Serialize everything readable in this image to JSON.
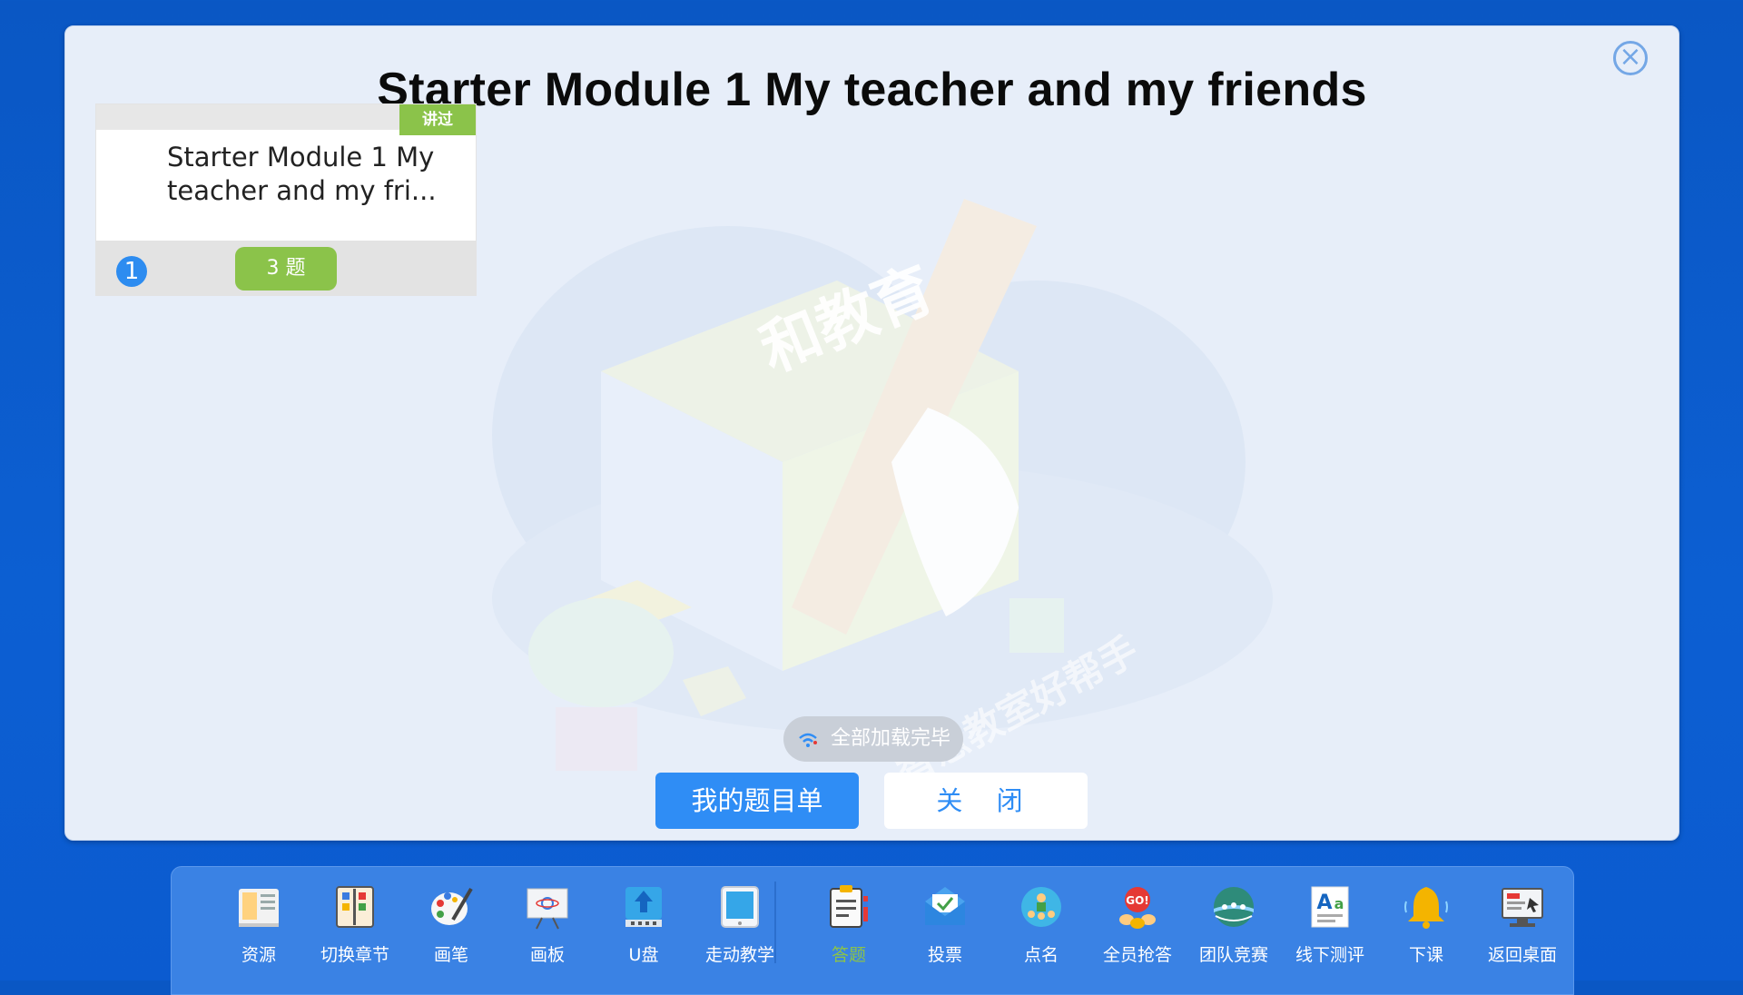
{
  "dialog": {
    "title": "Starter Module 1 My teacher and my friends",
    "close_icon": "close-circle-icon"
  },
  "watermark": {
    "text_main": "和教育",
    "text_sub": "智慧教室好帮手"
  },
  "card": {
    "tag": "讲过",
    "text": "Starter Module 1 My teacher and my fri...",
    "number": "1",
    "count": "3 题"
  },
  "status": {
    "loaded_text": "全部加载完毕",
    "loaded_icon": "wifi-icon"
  },
  "buttons": {
    "primary": "我的题目单",
    "close": "关 闭"
  },
  "dock": {
    "active_color": "#8bc34a",
    "items": [
      {
        "label": "资源",
        "icon": "book-icon"
      },
      {
        "label": "切换章节",
        "icon": "chapter-switch-icon"
      },
      {
        "label": "画笔",
        "icon": "palette-icon"
      },
      {
        "label": "画板",
        "icon": "whiteboard-icon"
      },
      {
        "label": "U盘",
        "icon": "usb-drive-icon"
      },
      {
        "label": "走动教学",
        "icon": "tablet-icon"
      },
      {
        "label": "答题",
        "icon": "answer-sheet-icon"
      },
      {
        "label": "投票",
        "icon": "vote-envelope-icon"
      },
      {
        "label": "点名",
        "icon": "roll-call-icon"
      },
      {
        "label": "全员抢答",
        "icon": "buzzer-go-icon"
      },
      {
        "label": "团队竞赛",
        "icon": "team-race-icon"
      },
      {
        "label": "线下测评",
        "icon": "font-test-icon"
      },
      {
        "label": "下课",
        "icon": "bell-icon"
      },
      {
        "label": "返回桌面",
        "icon": "desktop-icon"
      }
    ]
  }
}
